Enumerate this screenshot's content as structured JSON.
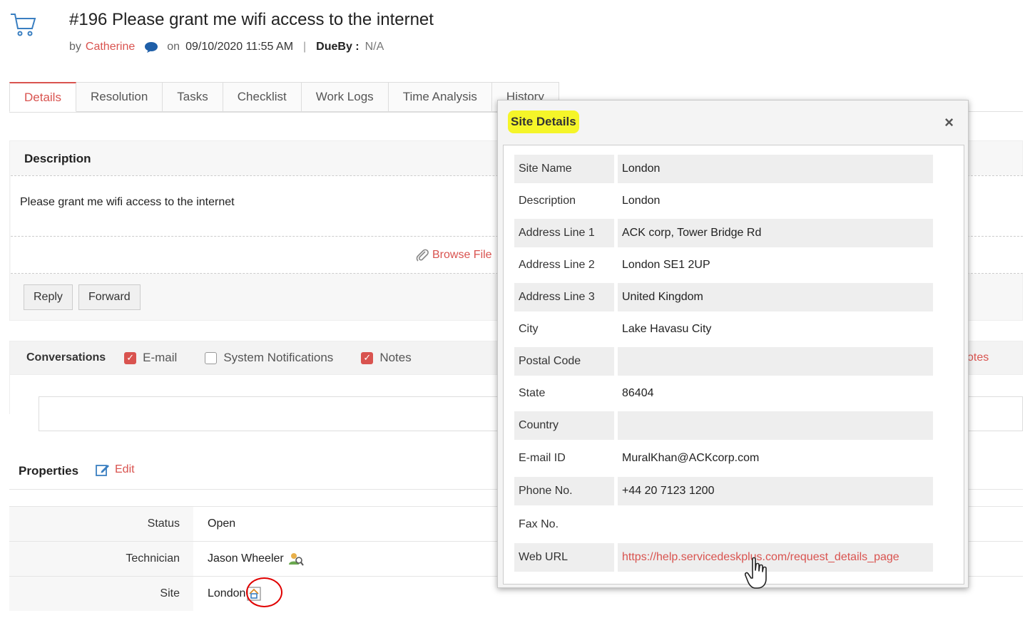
{
  "header": {
    "title": "#196  Please grant me wifi access to the internet",
    "by_label": "by",
    "author": "Catherine",
    "on_label": "on",
    "date": "09/10/2020 11:55 AM",
    "separator": "|",
    "dueby_label": "DueBy :",
    "dueby_value": "N/A"
  },
  "tabs": [
    "Details",
    "Resolution",
    "Tasks",
    "Checklist",
    "Work Logs",
    "Time Analysis",
    "History"
  ],
  "description": {
    "heading": "Description",
    "text": "Please grant me wifi access to the internet",
    "browse_label": "Browse File"
  },
  "actions": {
    "reply": "Reply",
    "forward": "Forward"
  },
  "conversations": {
    "label": "Conversations",
    "filters": [
      {
        "label": "E-mail",
        "checked": true
      },
      {
        "label": "System Notifications",
        "checked": false
      },
      {
        "label": "Notes",
        "checked": true
      }
    ],
    "notes_link": "otes"
  },
  "properties": {
    "heading": "Properties",
    "edit_label": "Edit",
    "rows": [
      {
        "label": "Status",
        "value": "Open"
      },
      {
        "label": "Technician",
        "value": "Jason Wheeler"
      },
      {
        "label": "Site",
        "value": "London"
      }
    ]
  },
  "modal": {
    "title": "Site Details",
    "close": "×",
    "rows": [
      {
        "label": "Site Name",
        "value": "London"
      },
      {
        "label": "Description",
        "value": "London"
      },
      {
        "label": "Address Line 1",
        "value": "ACK corp, Tower Bridge Rd"
      },
      {
        "label": "Address Line 2",
        "value": "London SE1 2UP"
      },
      {
        "label": "Address Line 3",
        "value": "United Kingdom"
      },
      {
        "label": "City",
        "value": "Lake Havasu City"
      },
      {
        "label": "Postal Code",
        "value": ""
      },
      {
        "label": "State",
        "value": "86404"
      },
      {
        "label": "Country",
        "value": ""
      },
      {
        "label": "E-mail ID",
        "value": "MuralKhan@ACKcorp.com"
      },
      {
        "label": "Phone No.",
        "value": "+44 20 7123 1200"
      },
      {
        "label": "Fax No.",
        "value": ""
      },
      {
        "label": "Web URL",
        "value": "https://help.servicedeskplus.com/request_details_page"
      }
    ]
  },
  "colors": {
    "accent": "#d9534f",
    "highlight": "#f5f529",
    "annotation": "#e00000"
  }
}
